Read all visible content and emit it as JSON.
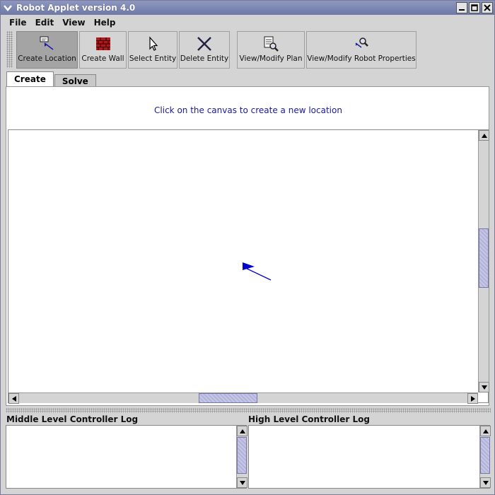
{
  "window": {
    "title": "Robot Applet version 4.0"
  },
  "menubar": {
    "items": [
      "File",
      "Edit",
      "View",
      "Help"
    ]
  },
  "toolbar": {
    "buttons": [
      {
        "label": "Create Location",
        "icon": "create-location-icon",
        "active": true
      },
      {
        "label": "Create Wall",
        "icon": "brick-wall-icon",
        "active": false
      },
      {
        "label": "Select Entity",
        "icon": "pointer-arrow-icon",
        "active": false
      },
      {
        "label": "Delete Entity",
        "icon": "x-delete-icon",
        "active": false
      },
      {
        "label": "View/Modify Plan",
        "icon": "plan-search-icon",
        "active": false
      },
      {
        "label": "View/Modify Robot Properties",
        "icon": "robot-properties-icon",
        "active": false
      }
    ]
  },
  "tabs": [
    {
      "label": "Create",
      "active": true
    },
    {
      "label": "Solve",
      "active": false
    }
  ],
  "create_panel": {
    "hint": "Click on the canvas to create a new location"
  },
  "logs": {
    "middle": {
      "title": "Middle Level Controller Log"
    },
    "high": {
      "title": "High Level Controller Log"
    }
  },
  "colors": {
    "accent": "#1a1a9a",
    "robot": "#0000cc",
    "scroll_thumb": "#b3b3d9"
  }
}
